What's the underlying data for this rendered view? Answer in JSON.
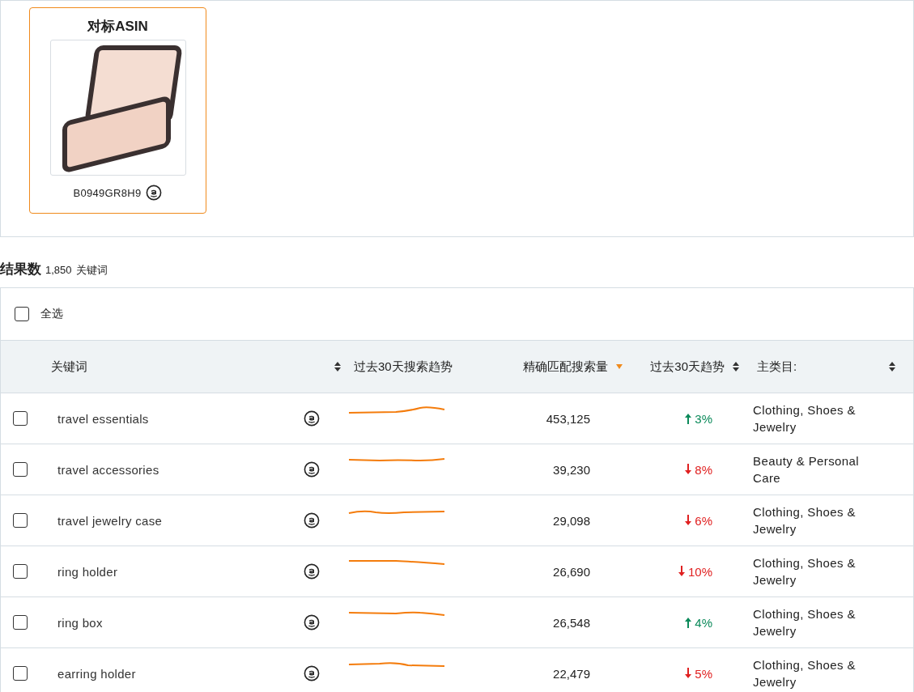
{
  "benchmark": {
    "title": "对标ASIN",
    "asin": "B0949GR8H9"
  },
  "results": {
    "label": "结果数",
    "count": "1,850",
    "unit": "关键词"
  },
  "select_all": {
    "label": "全选",
    "checked": false
  },
  "columns": [
    {
      "label": "关键词",
      "kind": "sortable"
    },
    {
      "label": "过去30天搜索趋势",
      "kind": "plain"
    },
    {
      "label": "精确匹配搜索量",
      "kind": "sorted"
    },
    {
      "label": "过去30天趋势",
      "kind": "sortable"
    },
    {
      "label": "主类目:",
      "kind": "sortable"
    }
  ],
  "rows": [
    {
      "keyword": "travel essentials",
      "checked": false,
      "volume": "453,125",
      "trend": "3%",
      "kind": "up",
      "category": "Clothing, Shoes & Jewelry"
    },
    {
      "keyword": "travel accessories",
      "checked": false,
      "volume": "39,230",
      "trend": "8%",
      "kind": "down",
      "category": "Beauty & Personal Care"
    },
    {
      "keyword": "travel jewelry case",
      "checked": false,
      "volume": "29,098",
      "trend": "6%",
      "kind": "down",
      "category": "Clothing, Shoes & Jewelry"
    },
    {
      "keyword": "ring holder",
      "checked": false,
      "volume": "26,690",
      "trend": "10%",
      "kind": "down",
      "category": "Clothing, Shoes & Jewelry"
    },
    {
      "keyword": "ring box",
      "checked": false,
      "volume": "26,548",
      "trend": "4%",
      "kind": "up",
      "category": "Clothing, Shoes & Jewelry"
    },
    {
      "keyword": "earring holder",
      "checked": false,
      "volume": "22,479",
      "trend": "5%",
      "kind": "down",
      "category": "Clothing, Shoes & Jewelry"
    }
  ]
}
